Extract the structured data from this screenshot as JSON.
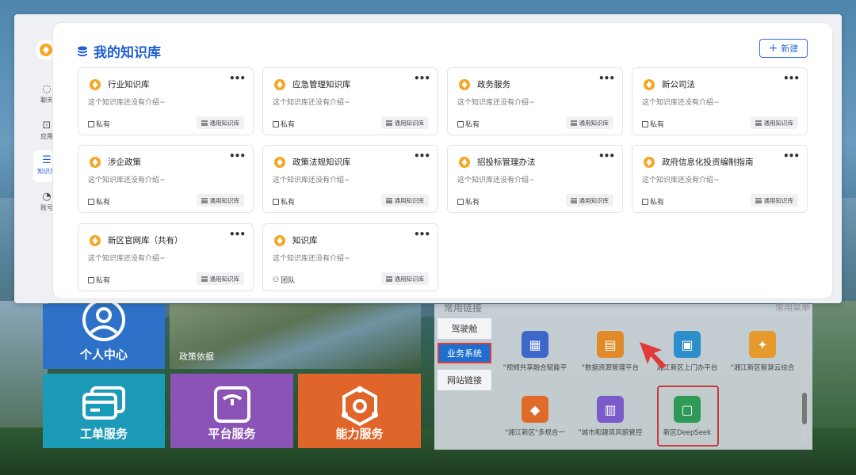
{
  "background": {
    "tiles": {
      "personal_center": "个人中心",
      "policy_basis": "政策依据",
      "work_order": "工单服务",
      "platform": "平台服务",
      "ability": "能力服务"
    },
    "links": {
      "title": "常用链接",
      "more": "常用菜单",
      "tabs": [
        "驾驶舱",
        "业务系统",
        "网站链接"
      ],
      "active_tab": "业务系统",
      "apps": [
        "\"视频共享融合赋能平",
        "\"数据资源管理平台",
        "湘江新区上门办平台",
        "\"湘江新区智慧云综合",
        "\"湘江新区\"多规合一",
        "\"城市和建筑风貌管控",
        "新区DeepSeek"
      ],
      "highlighted_app": "新区DeepSeek",
      "accent": "#1f6fd0",
      "highlight_color": "#c83a3a"
    }
  },
  "rail": {
    "items": [
      "聊天",
      "应用",
      "知识库",
      "账号"
    ],
    "active": "知识库"
  },
  "header": {
    "title": "我的知识库",
    "new_button": "新建"
  },
  "cards": [
    {
      "title": "行业知识库",
      "desc": "这个知识库还没有介绍~",
      "visibility": "私有",
      "tag": "通用知识库"
    },
    {
      "title": "应急管理知识库",
      "desc": "这个知识库还没有介绍~",
      "visibility": "私有",
      "tag": "通用知识库"
    },
    {
      "title": "政务服务",
      "desc": "这个知识库还没有介绍~",
      "visibility": "私有",
      "tag": "通用知识库"
    },
    {
      "title": "新公司法",
      "desc": "这个知识库还没有介绍~",
      "visibility": "私有",
      "tag": "通用知识库"
    },
    {
      "title": "涉企政策",
      "desc": "这个知识库还没有介绍~",
      "visibility": "私有",
      "tag": "通用知识库"
    },
    {
      "title": "政策法规知识库",
      "desc": "这个知识库还没有介绍~",
      "visibility": "私有",
      "tag": "通用知识库"
    },
    {
      "title": "招投标管理办法",
      "desc": "这个知识库还没有介绍~",
      "visibility": "私有",
      "tag": "通用知识库"
    },
    {
      "title": "政府信息化投资编制指南",
      "desc": "这个知识库还没有介绍~",
      "visibility": "私有",
      "tag": "通用知识库"
    },
    {
      "title": "新区官网库（共有）",
      "desc": "这个知识库还没有介绍~",
      "visibility": "私有",
      "tag": "通用知识库"
    },
    {
      "title": "知识库",
      "desc": "这个知识库还没有介绍~",
      "visibility": "团队",
      "tag": "通用知识库"
    }
  ],
  "card_more": "•••",
  "colors": {
    "primary": "#1f5fd1",
    "logo_orange": "#f5a623"
  }
}
